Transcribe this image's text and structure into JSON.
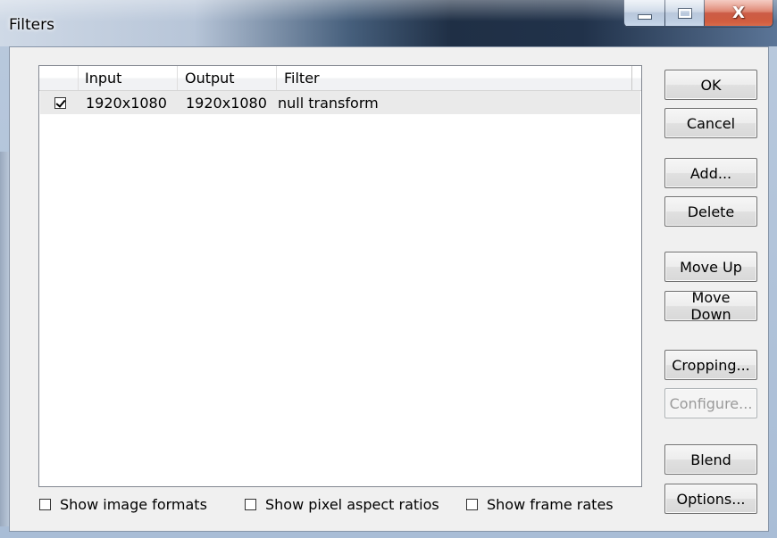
{
  "window": {
    "title": "Filters"
  },
  "listview": {
    "columns": [
      "",
      "Input",
      "Output",
      "Filter"
    ],
    "rows": [
      {
        "checked": true,
        "input": "1920x1080",
        "output": "1920x1080",
        "filter": "null transform"
      }
    ]
  },
  "buttons": {
    "ok": "OK",
    "cancel": "Cancel",
    "add": "Add...",
    "delete": "Delete",
    "move_up": "Move Up",
    "move_down": "Move Down",
    "cropping": "Cropping...",
    "configure": "Configure...",
    "blend": "Blend",
    "options": "Options..."
  },
  "options": {
    "show_image_formats": {
      "label": "Show image formats",
      "checked": false
    },
    "show_pixel_aspect_ratios": {
      "label": "Show pixel aspect ratios",
      "checked": false
    },
    "show_frame_rates": {
      "label": "Show frame rates",
      "checked": false
    }
  },
  "icons": {
    "minimize": "minimize-icon",
    "maximize": "maximize-icon",
    "close": "close-icon",
    "close_glyph": "X"
  }
}
